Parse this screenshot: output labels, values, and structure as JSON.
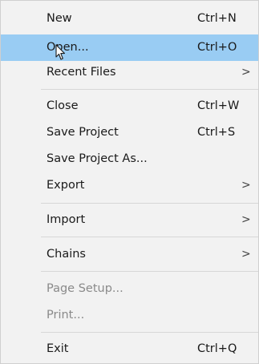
{
  "menu": {
    "items": [
      {
        "label": "New",
        "shortcut": "Ctrl+N"
      },
      {
        "label": "Open...",
        "shortcut": "Ctrl+O",
        "state": "highlighted"
      },
      {
        "label": "Recent Files",
        "submenu": ">"
      },
      {
        "label": "Close",
        "shortcut": "Ctrl+W"
      },
      {
        "label": "Save Project",
        "shortcut": "Ctrl+S"
      },
      {
        "label": "Save Project As..."
      },
      {
        "label": "Export",
        "submenu": ">"
      },
      {
        "label": "Import",
        "submenu": ">"
      },
      {
        "label": "Chains",
        "submenu": ">"
      },
      {
        "label": "Page Setup...",
        "state": "disabled"
      },
      {
        "label": "Print...",
        "state": "disabled"
      },
      {
        "label": "Exit",
        "shortcut": "Ctrl+Q"
      }
    ]
  },
  "colors": {
    "menu_background": "#f2f2f2",
    "highlight": "#99ccf3",
    "disabled_text": "#8a8a8a",
    "separator": "#d7d7d7"
  },
  "cursor": {
    "icon": "mouse-pointer-icon"
  }
}
